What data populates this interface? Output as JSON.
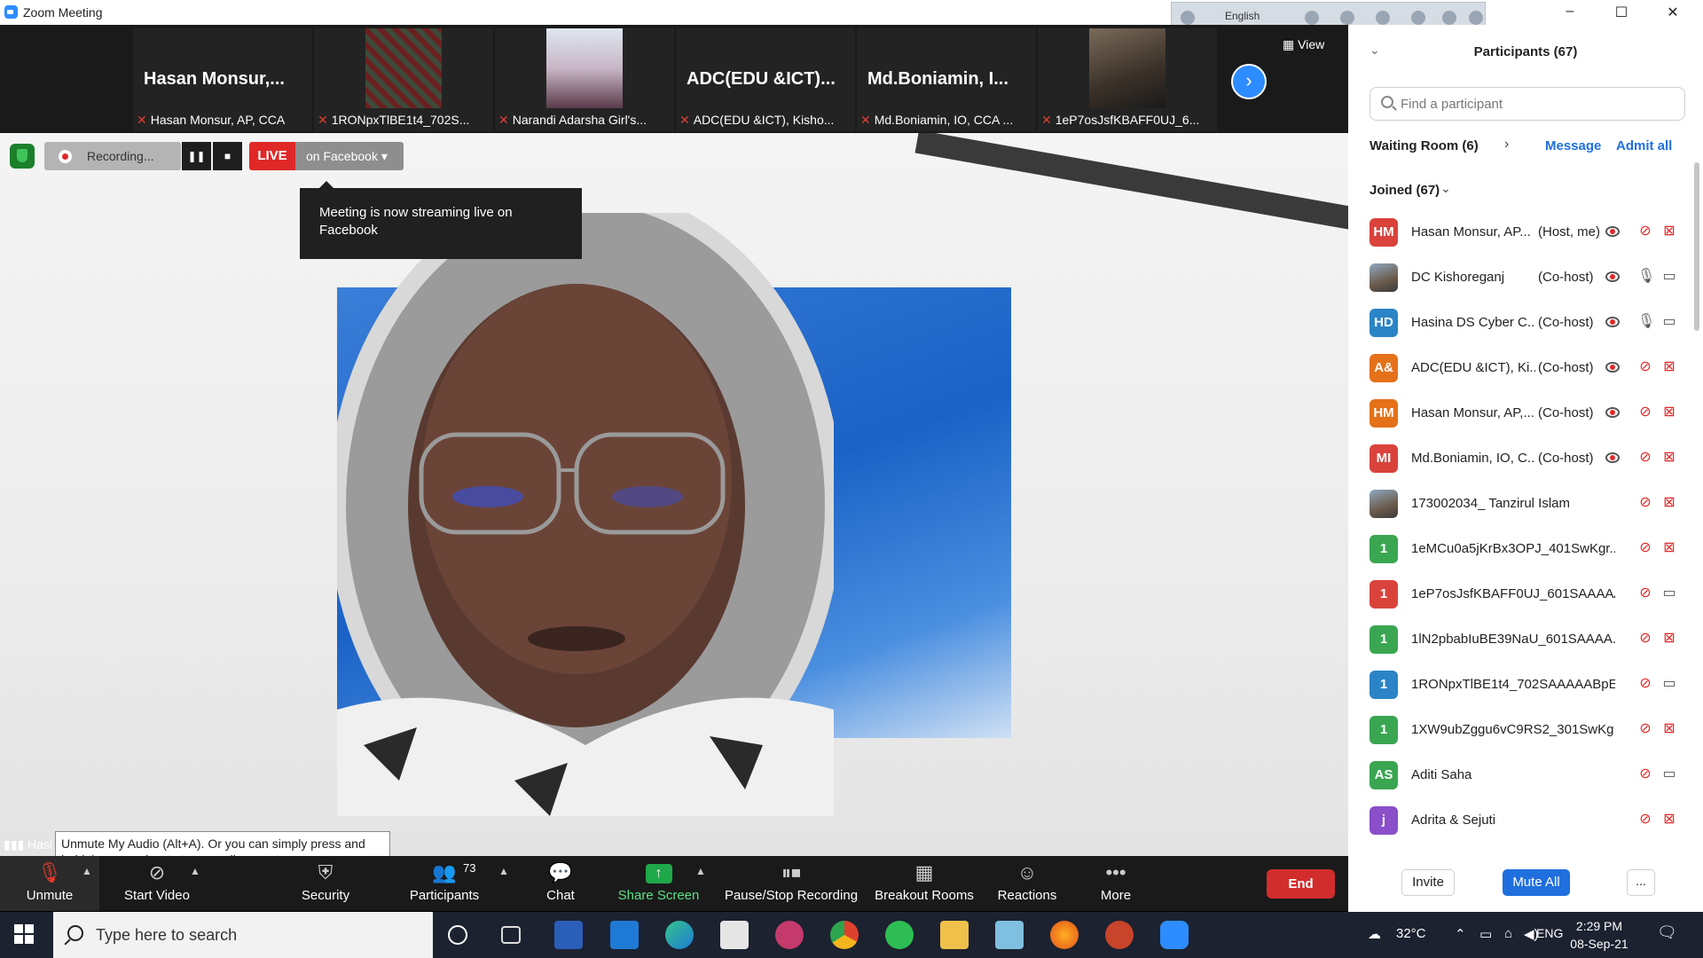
{
  "window": {
    "title": "Zoom Meeting",
    "language": "English",
    "controls": {
      "minimize": "–",
      "maximize": "☐",
      "close": "✕"
    }
  },
  "thumbnails": [
    {
      "name": "Hasan  Monsur,...",
      "label": "Hasan Monsur, AP, CCA",
      "type": "text"
    },
    {
      "name": "",
      "label": "1RONpxTlBE1t4_702S...",
      "type": "image"
    },
    {
      "name": "",
      "label": "Narandi Adarsha Girl's...",
      "type": "image"
    },
    {
      "name": "ADC(EDU  &ICT)...",
      "label": "ADC(EDU &ICT), Kisho...",
      "type": "text"
    },
    {
      "name": "Md.Boniamin,  I...",
      "label": "Md.Boniamin, IO, CCA ...",
      "type": "text"
    },
    {
      "name": "",
      "label": "1eP7osJsfKBAFF0UJ_6...",
      "type": "image"
    }
  ],
  "view_label": "View",
  "recording": {
    "label": "Recording...",
    "live_label": "LIVE",
    "stream_target": "on Facebook",
    "tooltip": "Meeting is now streaming live on Facebook"
  },
  "audio_hint": {
    "speaker_prefix": "Hasi",
    "text": "Unmute My Audio (Alt+A). Or you can simply press and hold the space bar to temporarily unmute."
  },
  "toolbar": {
    "unmute": "Unmute",
    "start_video": "Start Video",
    "security": "Security",
    "participants": "Participants",
    "participants_count": "73",
    "chat": "Chat",
    "share_screen": "Share Screen",
    "pause_stop_recording": "Pause/Stop Recording",
    "breakout_rooms": "Breakout Rooms",
    "reactions": "Reactions",
    "more": "More",
    "end": "End"
  },
  "panel": {
    "title": "Participants (67)",
    "search_placeholder": "Find a participant",
    "waiting_room": "Waiting Room (6)",
    "message": "Message",
    "admit_all": "Admit all",
    "joined": "Joined (67)",
    "invite": "Invite",
    "mute_all": "Mute All",
    "more": "...",
    "participants": [
      {
        "initials": "HM",
        "color": "#d9433c",
        "name": "Hasan Monsur, AP...",
        "role": "(Host, me)",
        "recording": true,
        "mic": "off",
        "cam": "off"
      },
      {
        "initials": "",
        "color": "photo",
        "name": "DC Kishoreganj",
        "role": "(Co-host)",
        "recording": true,
        "mic": "on",
        "cam": "on"
      },
      {
        "initials": "HD",
        "color": "#2b84c6",
        "name": "Hasina DS Cyber C...",
        "role": "(Co-host)",
        "recording": true,
        "mic": "on",
        "cam": "on"
      },
      {
        "initials": "A&",
        "color": "#e5711a",
        "name": "ADC(EDU &ICT), Ki...",
        "role": "(Co-host)",
        "recording": true,
        "mic": "off",
        "cam": "off"
      },
      {
        "initials": "HM",
        "color": "#e5711a",
        "name": "Hasan Monsur, AP,...",
        "role": "(Co-host)",
        "recording": true,
        "mic": "off",
        "cam": "off"
      },
      {
        "initials": "MI",
        "color": "#d9433c",
        "name": "Md.Boniamin, IO, C...",
        "role": "(Co-host)",
        "recording": true,
        "mic": "off",
        "cam": "off"
      },
      {
        "initials": "",
        "color": "photo",
        "name": "173002034_ Tanzirul Islam",
        "role": "",
        "recording": false,
        "mic": "off",
        "cam": "off"
      },
      {
        "initials": "1",
        "color": "#3aa651",
        "name": "1eMCu0a5jKrBx3OPJ_401SwKgr...",
        "role": "",
        "recording": false,
        "mic": "off",
        "cam": "off"
      },
      {
        "initials": "1",
        "color": "#d9433c",
        "name": "1eP7osJsfKBAFF0UJ_601SAAAAA...",
        "role": "",
        "recording": false,
        "mic": "off",
        "cam": "on"
      },
      {
        "initials": "1",
        "color": "#3aa651",
        "name": "1lN2pbabIuBE39NaU_601SAAAA...",
        "role": "",
        "recording": false,
        "mic": "off",
        "cam": "off"
      },
      {
        "initials": "1",
        "color": "#2b84c6",
        "name": "1RONpxTlBE1t4_702SAAAAABpE...",
        "role": "",
        "recording": false,
        "mic": "off",
        "cam": "on"
      },
      {
        "initials": "1",
        "color": "#3aa651",
        "name": "1XW9ubZggu6vC9RS2_301SwKg...",
        "role": "",
        "recording": false,
        "mic": "off",
        "cam": "off"
      },
      {
        "initials": "AS",
        "color": "#3aa651",
        "name": "Aditi Saha",
        "role": "",
        "recording": false,
        "mic": "off",
        "cam": "on"
      },
      {
        "initials": "j",
        "color": "#8a4fc9",
        "name": "Adrita & Sejuti",
        "role": "",
        "recording": false,
        "mic": "off",
        "cam": "off"
      }
    ]
  },
  "taskbar": {
    "search_placeholder": "Type here to search",
    "temperature": "32°C",
    "input_lang": "ENG",
    "time": "2:29 PM",
    "date": "08-Sep-21"
  },
  "colors": {
    "accent": "#2d8cff",
    "live_red": "#e02828",
    "end_red": "#d12d2d",
    "share_green": "#1fa84a",
    "link_blue": "#1f6fde"
  }
}
